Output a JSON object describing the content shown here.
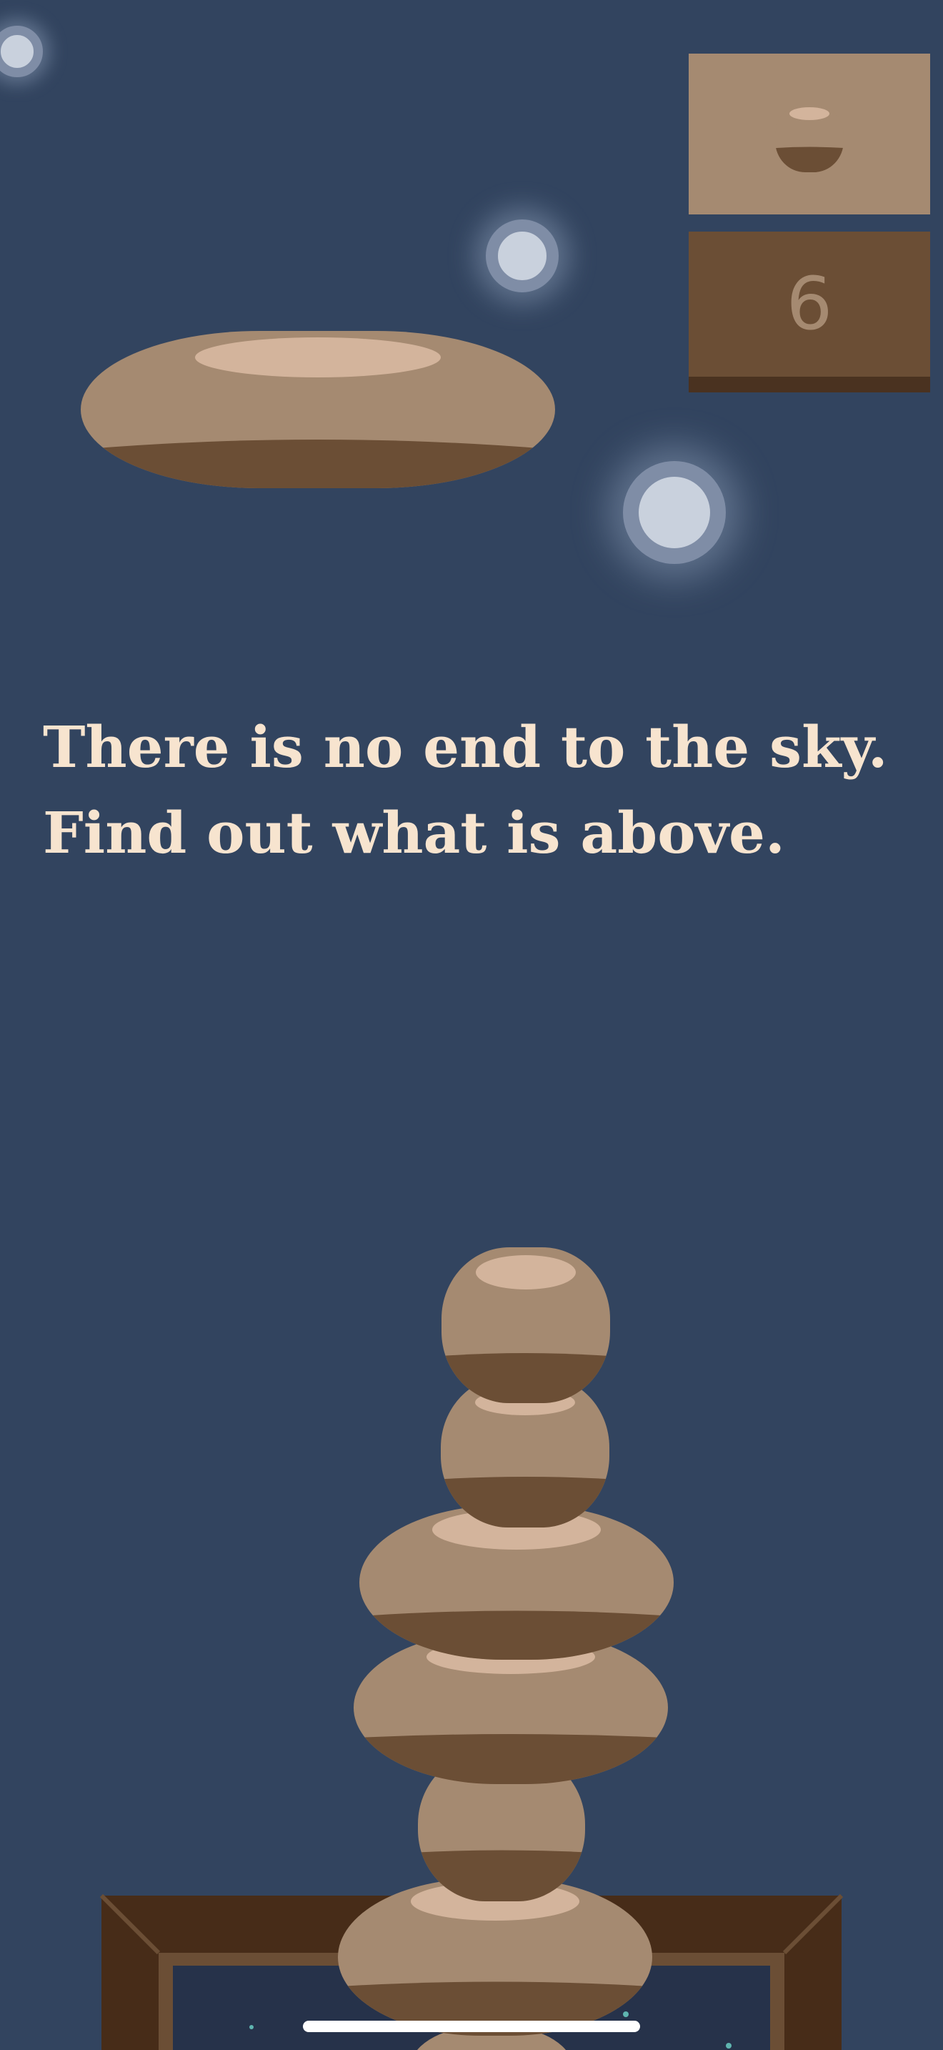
{
  "game": {
    "score": "6",
    "next_stone_icon": "stone-icon",
    "tagline_lines": [
      "There is no end to the sky.",
      "Find out what is above."
    ]
  },
  "colors": {
    "sky": "#32445f",
    "stone_body": "#a58a71",
    "stone_shadow": "#6b4e35",
    "stone_highlight": "#d3b49c",
    "frame_dark": "#472c18",
    "frame_mid": "#6b4e35",
    "star_core": "#c9d1dd",
    "star_ring": "#7f8da6",
    "text": "#f7e4cf"
  }
}
